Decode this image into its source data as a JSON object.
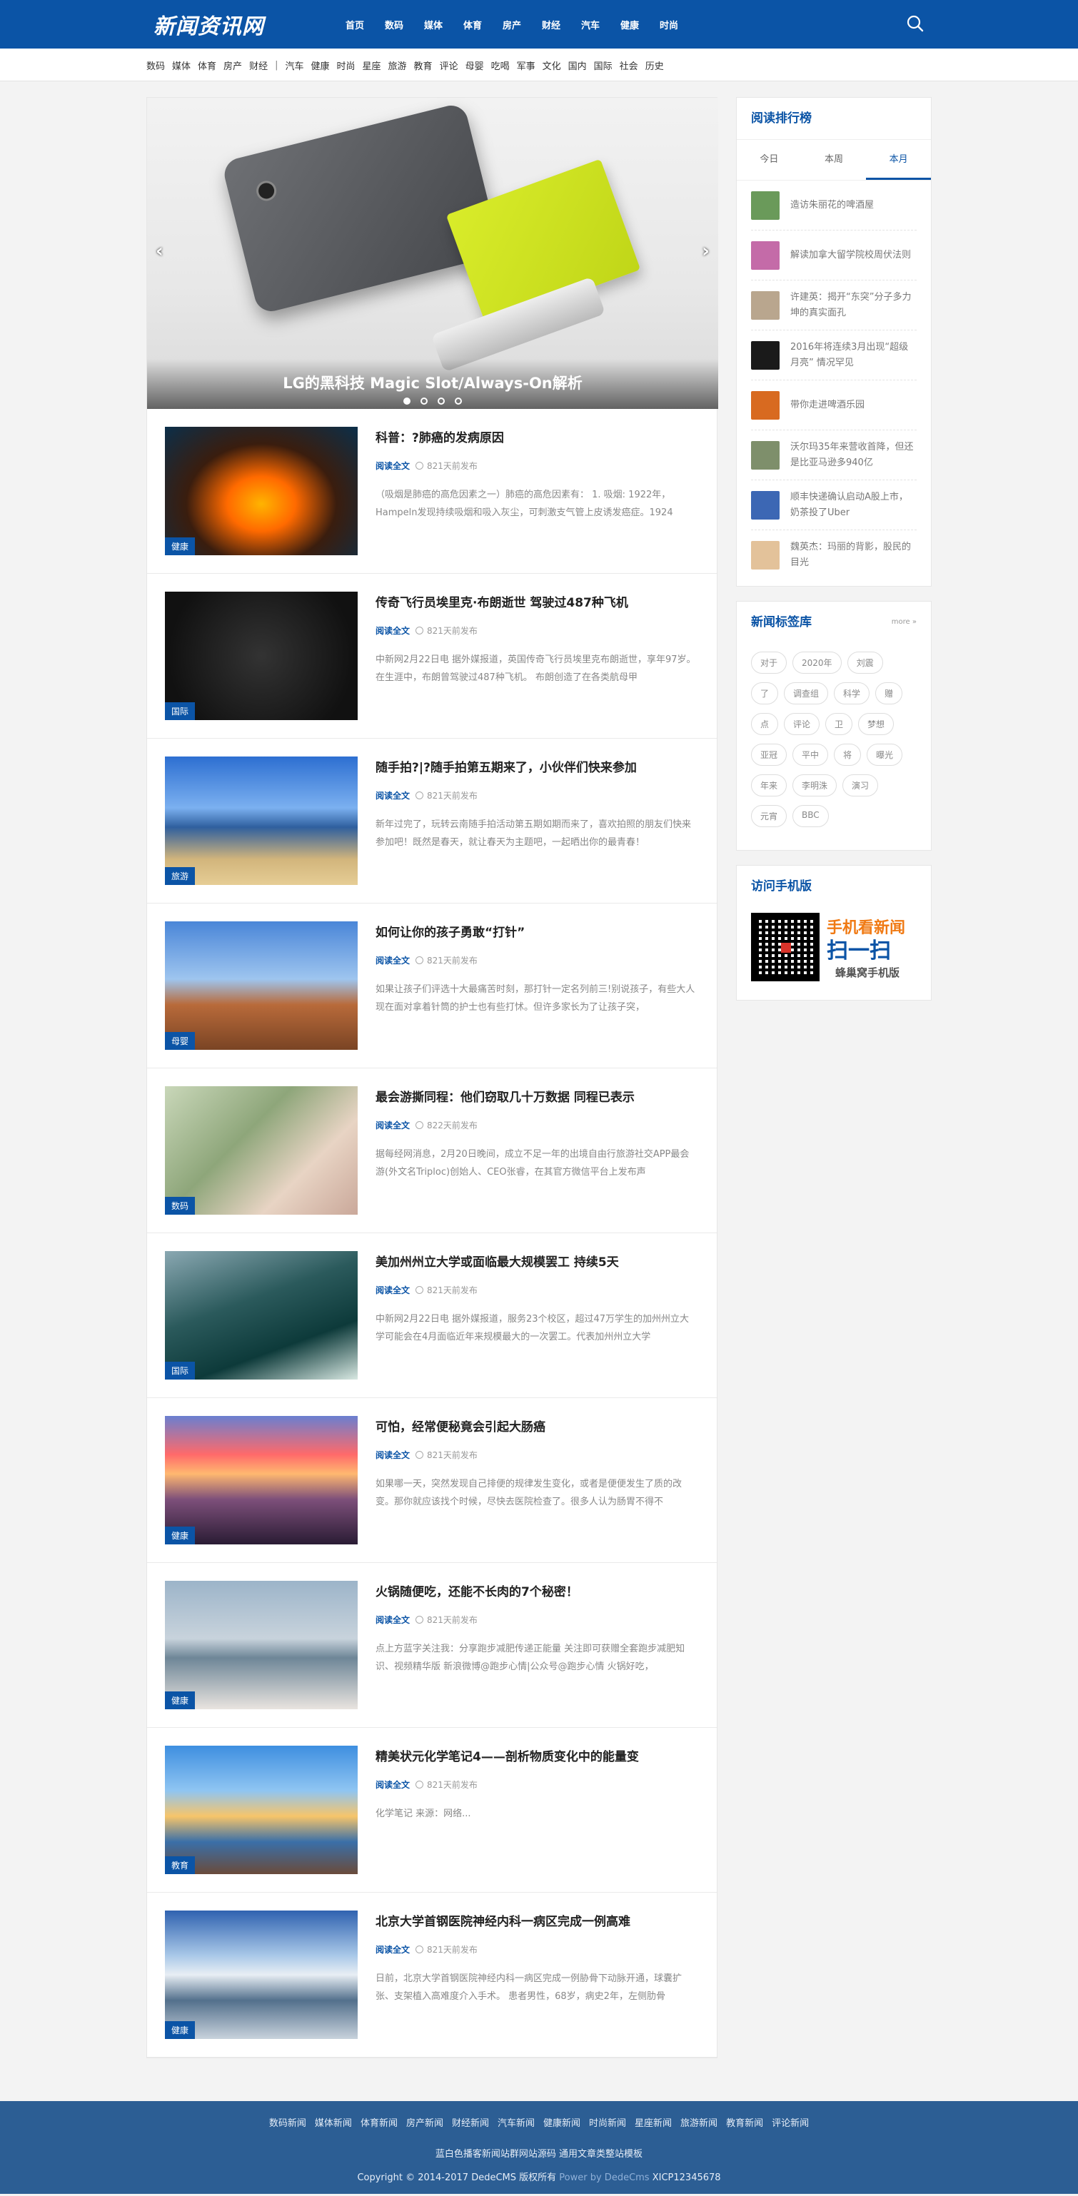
{
  "header": {
    "logo": "新闻资讯网",
    "nav": [
      "首页",
      "数码",
      "媒体",
      "体育",
      "房产",
      "财经",
      "汽车",
      "健康",
      "时尚"
    ]
  },
  "subnav": {
    "group1": [
      "数码",
      "媒体",
      "体育",
      "房产",
      "财经"
    ],
    "separator": "|",
    "group2": [
      "汽车",
      "健康",
      "时尚",
      "星座",
      "旅游",
      "教育",
      "评论",
      "母婴",
      "吃喝",
      "军事",
      "文化",
      "国内",
      "国际",
      "社会",
      "历史"
    ]
  },
  "slider": {
    "caption": "LG的黑科技 Magic Slot/Always-On解析",
    "prev": "‹",
    "next": "›",
    "dot_count": 4,
    "active_dot": 0
  },
  "articles": [
    {
      "tag": "健康",
      "title": "科普：?肺癌的发病原因",
      "read": "阅读全文",
      "time": "821天前发布",
      "desc": "（吸烟是肺癌的高危因素之一）肺癌的高危因素有： 1. 吸烟: 1922年，Hampeln发现持续吸烟和吸入灰尘，可刺激支气管上皮诱发癌症。1924"
    },
    {
      "tag": "国际",
      "title": "传奇飞行员埃里克·布朗逝世 驾驶过487种飞机",
      "read": "阅读全文",
      "time": "821天前发布",
      "desc": "中新网2月22日电 据外媒报道，英国传奇飞行员埃里克布朗逝世，享年97岁。在生涯中，布朗曾驾驶过487种飞机。 布朗创造了在各类航母甲"
    },
    {
      "tag": "旅游",
      "title": "随手拍?|?随手拍第五期来了，小伙伴们快来参加",
      "read": "阅读全文",
      "time": "821天前发布",
      "desc": "新年过完了，玩转云南随手拍活动第五期如期而来了，喜欢拍照的朋友们快来参加吧！既然是春天，就让春天为主题吧，一起晒出你的最青春！"
    },
    {
      "tag": "母婴",
      "title": "如何让你的孩子勇敢“打针”",
      "read": "阅读全文",
      "time": "821天前发布",
      "desc": "如果让孩子们评选十大最痛苦时刻，那打针一定名列前三!别说孩子，有些大人现在面对拿着针筒的护士也有些打怵。但许多家长为了让孩子突，"
    },
    {
      "tag": "数码",
      "title": "最会游撕同程：他们窃取几十万数据 同程已表示",
      "read": "阅读全文",
      "time": "822天前发布",
      "desc": "据每经网消息，2月20日晚间，成立不足一年的出境自由行旅游社交APP最会游(外文名Triploc)创始人、CEO张睿，在其官方微信平台上发布声"
    },
    {
      "tag": "国际",
      "title": "美加州州立大学或面临最大规模罢工 持续5天",
      "read": "阅读全文",
      "time": "821天前发布",
      "desc": "中新网2月22日电 据外媒报道，服务23个校区，超过47万学生的加州州立大学可能会在4月面临近年来规模最大的一次罢工。代表加州州立大学"
    },
    {
      "tag": "健康",
      "title": "可怕，经常便秘竟会引起大肠癌",
      "read": "阅读全文",
      "time": "821天前发布",
      "desc": "如果哪一天，突然发现自己排便的规律发生变化，或者是便便发生了质的改变。那你就应该找个时候，尽快去医院检查了。很多人认为肠胃不得不"
    },
    {
      "tag": "健康",
      "title": "火锅随便吃，还能不长肉的7个秘密！",
      "read": "阅读全文",
      "time": "821天前发布",
      "desc": "点上方蓝字关注我：分享跑步减肥传递正能量 关注即可获赠全套跑步减肥知识、视频精华版 新浪微博@跑步心情|公众号@跑步心情 火锅好吃，"
    },
    {
      "tag": "教育",
      "title": "精美状元化学笔记4——剖析物质变化中的能量变",
      "read": "阅读全文",
      "time": "821天前发布",
      "desc": "化学笔记 来源：网络..."
    },
    {
      "tag": "健康",
      "title": "北京大学首钢医院神经内科一病区完成一例高难",
      "read": "阅读全文",
      "time": "821天前发布",
      "desc": "日前，北京大学首钢医院神经内科一病区完成一例胁骨下动脉开通，球囊扩张、支架植入高难度介入手术。 患者男性，68岁，病史2年，左侧肋骨"
    }
  ],
  "rank": {
    "title": "阅读排行榜",
    "tabs": [
      "今日",
      "本周",
      "本月"
    ],
    "active_tab": 2,
    "items": [
      "造访朱丽花的啤酒屋",
      "解读加拿大留学院校周伏法则",
      "许建英：揭开“东突”分子多力坤的真实面孔",
      "2016年将连续3月出现“超级月亮” 情况罕见",
      "带你走进啤酒乐园",
      "沃尔玛35年来营收首降，但还是比亚马逊多940亿",
      "顺丰快递确认启动A股上市，奶茶投了Uber",
      "魏英杰：玛丽的背影，股民的目光"
    ]
  },
  "tags": {
    "title": "新闻标签库",
    "more": "more »",
    "items": [
      "对于",
      "2020年",
      "刘震",
      "了",
      "调查组",
      "科学",
      "赠",
      "点",
      "评论",
      "卫",
      "梦想",
      "亚冠",
      "平中",
      "将",
      "曝光",
      "年来",
      "李明洙",
      "演习",
      "元宵",
      "BBC"
    ]
  },
  "mobile": {
    "title": "访问手机版",
    "line1": "手机看新闻",
    "line2": "扫一扫",
    "line3": "蜂巢窝手机版"
  },
  "footer": {
    "links": [
      "数码新闻",
      "媒体新闻",
      "体育新闻",
      "房产新闻",
      "财经新闻",
      "汽车新闻",
      "健康新闻",
      "时尚新闻",
      "星座新闻",
      "旅游新闻",
      "教育新闻",
      "评论新闻"
    ],
    "line1": "蓝白色播客新闻站群网站源码 通用文章类整站模板",
    "copyright": "Copyright © 2014-2017 DedeCMS 版权所有",
    "power": "Power by DedeCms",
    "icp": "XICP12345678"
  },
  "colors": {
    "brand": "#0b54a6",
    "footer": "#2c5e94"
  }
}
